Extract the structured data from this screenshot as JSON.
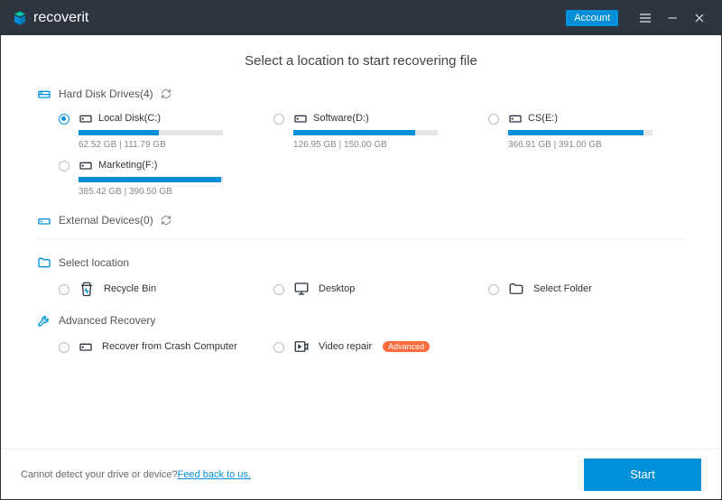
{
  "app": {
    "name": "recoverit",
    "account_label": "Account"
  },
  "main_title": "Select a location to start recovering file",
  "sections": {
    "hdd": {
      "title": "Hard Disk Drives(4)",
      "drives": [
        {
          "name": "Local Disk(C:)",
          "used": 62.52,
          "total": 111.79,
          "size_text": "62.52  GB | 111.79  GB",
          "selected": true
        },
        {
          "name": "Software(D:)",
          "used": 126.95,
          "total": 150.0,
          "size_text": "126.95  GB | 150.00  GB",
          "selected": false
        },
        {
          "name": "CS(E:)",
          "used": 366.91,
          "total": 391.0,
          "size_text": "366.91  GB | 391.00  GB",
          "selected": false
        },
        {
          "name": "Marketing(F:)",
          "used": 385.42,
          "total": 390.5,
          "size_text": "385.42  GB | 390.50  GB",
          "selected": false
        }
      ]
    },
    "external": {
      "title": "External Devices(0)"
    },
    "select_location": {
      "title": "Select location",
      "items": [
        {
          "label": "Recycle Bin",
          "icon": "recycle-bin-icon"
        },
        {
          "label": "Desktop",
          "icon": "desktop-icon"
        },
        {
          "label": "Select Folder",
          "icon": "folder-icon"
        }
      ]
    },
    "advanced": {
      "title": "Advanced Recovery",
      "items": [
        {
          "label": "Recover from Crash Computer",
          "icon": "disk-icon",
          "badge": null
        },
        {
          "label": "Video repair",
          "icon": "video-repair-icon",
          "badge": "Advanced"
        }
      ]
    }
  },
  "footer": {
    "text": "Cannot detect your drive or device? ",
    "link": "Feed back to us.",
    "start_label": "Start"
  }
}
